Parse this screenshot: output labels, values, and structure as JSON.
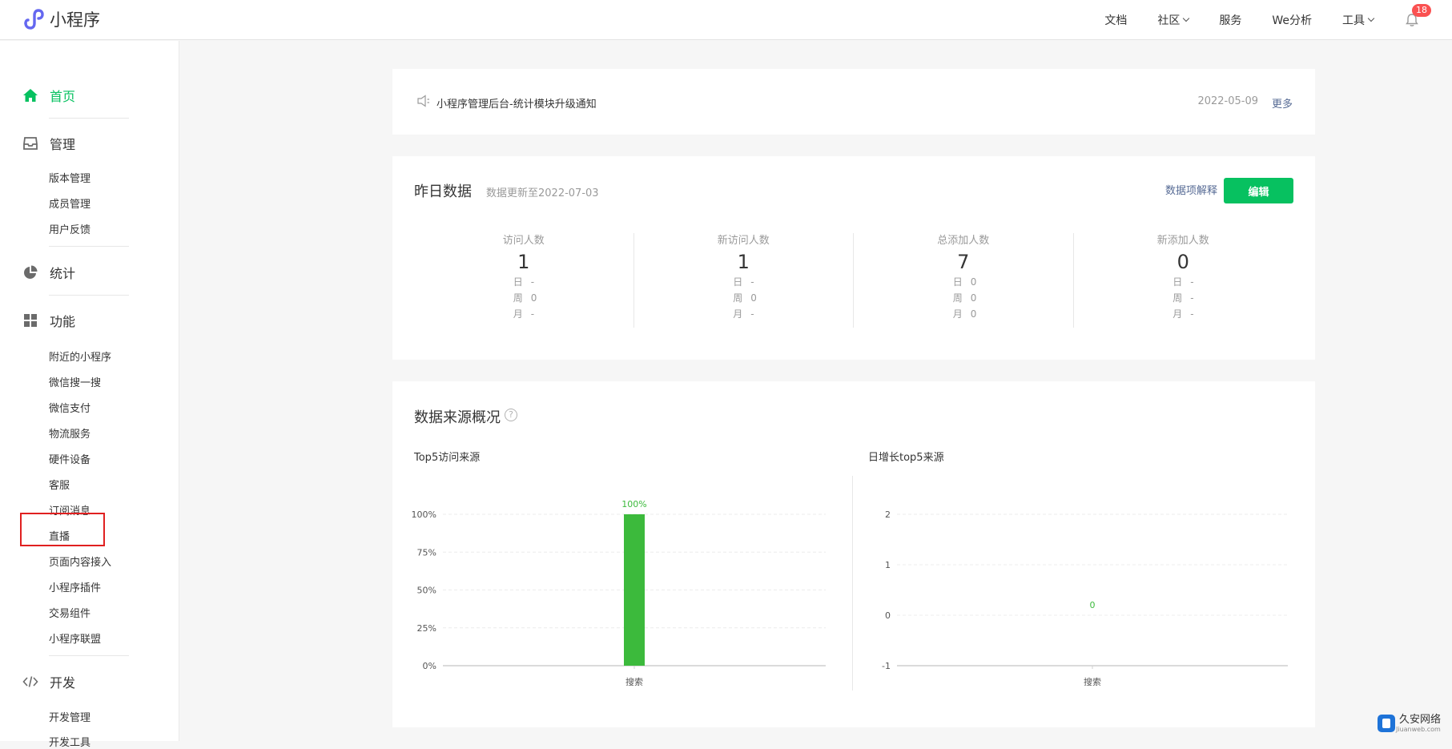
{
  "app": {
    "title": "小程序"
  },
  "topnav": {
    "items": [
      "文档",
      "社区",
      "服务",
      "We分析",
      "工具"
    ],
    "notification_count": "18"
  },
  "sidebar": {
    "home": "首页",
    "manage": {
      "label": "管理",
      "items": [
        "版本管理",
        "成员管理",
        "用户反馈"
      ]
    },
    "stats": "统计",
    "features": {
      "label": "功能",
      "items": [
        "附近的小程序",
        "微信搜一搜",
        "微信支付",
        "物流服务",
        "硬件设备",
        "客服",
        "订阅消息",
        "直播",
        "页面内容接入",
        "小程序插件",
        "交易组件",
        "小程序联盟"
      ]
    },
    "dev": {
      "label": "开发",
      "items": [
        "开发管理",
        "开发工具"
      ]
    }
  },
  "notice": {
    "text": "小程序管理后台-统计模块升级通知",
    "date": "2022-05-09",
    "more": "更多"
  },
  "yesterday": {
    "title": "昨日数据",
    "updated": "数据更新至2022-07-03",
    "explain": "数据项解释",
    "edit": "编辑",
    "stats": [
      {
        "label": "访问人数",
        "value": "1",
        "day_label": "日",
        "day": "-",
        "week_label": "周",
        "week": "0",
        "month_label": "月",
        "month": "-"
      },
      {
        "label": "新访问人数",
        "value": "1",
        "day_label": "日",
        "day": "-",
        "week_label": "周",
        "week": "0",
        "month_label": "月",
        "month": "-"
      },
      {
        "label": "总添加人数",
        "value": "7",
        "day_label": "日",
        "day": "0",
        "week_label": "周",
        "week": "0",
        "month_label": "月",
        "month": "0"
      },
      {
        "label": "新添加人数",
        "value": "0",
        "day_label": "日",
        "day": "-",
        "week_label": "周",
        "week": "-",
        "month_label": "月",
        "month": "-"
      }
    ]
  },
  "sources": {
    "title": "数据来源概况",
    "help": "?"
  },
  "chart_data": [
    {
      "type": "bar",
      "title": "Top5访问来源",
      "categories": [
        "搜索"
      ],
      "values": [
        100
      ],
      "data_labels": [
        "100%"
      ],
      "yticks": [
        "0%",
        "25%",
        "50%",
        "75%",
        "100%"
      ],
      "ylim": [
        0,
        100
      ],
      "grid": true,
      "color": "#3cba3c"
    },
    {
      "type": "bar",
      "title": "日增长top5来源",
      "categories": [
        "搜索"
      ],
      "values": [
        0
      ],
      "data_labels": [
        "0"
      ],
      "yticks": [
        "-1",
        "0",
        "1",
        "2"
      ],
      "ylim": [
        -1,
        2
      ],
      "grid": true,
      "color": "#3cba3c"
    }
  ],
  "watermark": {
    "name": "久安网络",
    "url": "Jiuanweb.com"
  },
  "colors": {
    "accent": "#07c160",
    "link": "#576b95",
    "highlight": "#e02020"
  }
}
